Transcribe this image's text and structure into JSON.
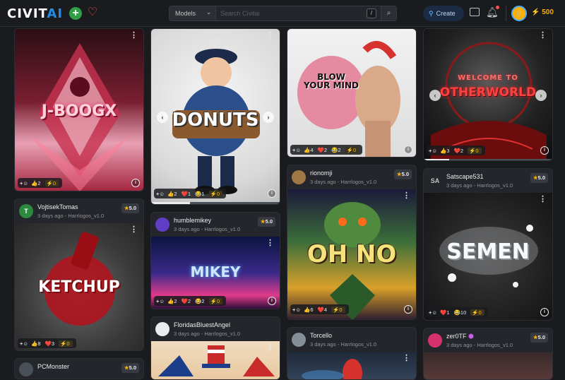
{
  "header": {
    "logo_main": "CIVIT",
    "logo_ai": "AI",
    "search_select": "Models",
    "search_placeholder": "Search Civitai",
    "slash_key": "/",
    "create_label": "Create",
    "buzz_amount": "500"
  },
  "cards": {
    "c1": {
      "art_text": "J-BOOGX",
      "likes": "2",
      "tips": "0"
    },
    "c2": {
      "art_text": "DONUTS",
      "likes": "2",
      "hearts": "1",
      "laugh": "1",
      "tips": "0",
      "progress": 0.3
    },
    "c3": {
      "art_text": "BLOW YOUR MIND",
      "likes": "4",
      "hearts": "2",
      "laugh": "2",
      "tips": "0"
    },
    "c4": {
      "art_text": "WELCOME TO",
      "art_text2": "OTHERWORLD",
      "likes": "3",
      "hearts": "2",
      "tips": "0",
      "progress": 0.2
    },
    "c5": {
      "user": "VojtisekTomas",
      "avatar": "T",
      "meta": "3 days ago - Harrlogos_v1.0",
      "rating": "5.0",
      "art_text": "KETCHUP",
      "likes": "8",
      "hearts": "3",
      "tips": "0"
    },
    "c6": {
      "user": "humblemikey",
      "meta": "3 days ago - Harrlogos_v1.0",
      "rating": "5.0",
      "art_text": "MIKEY",
      "likes": "2",
      "hearts": "2",
      "laugh": "2",
      "tips": "0"
    },
    "c7": {
      "user": "rionomji",
      "meta": "3 days ago - Harrlogos_v1.0",
      "rating": "5.0",
      "art_text": "OH NO",
      "likes": "6",
      "hearts": "4",
      "tips": "0"
    },
    "c8": {
      "user": "Satscape531",
      "avatar": "SA",
      "meta": "3 days ago - Harrlogos_v1.0",
      "rating": "5.0",
      "art_text": "SEMEN",
      "hearts": "1",
      "laugh": "10",
      "tips": "0"
    },
    "c9": {
      "user": "FloridasBluestAngel",
      "meta": "3 days ago - Harrlogos_v1.0"
    },
    "c10": {
      "user": "Torcello",
      "meta": "3 days ago - Harrlogos_v1.0"
    },
    "c11": {
      "user": "zer0TF",
      "meta": "3 days ago - Harrlogos_v1.0",
      "rating": "5.0"
    },
    "c12": {
      "user": "PCMonster",
      "rating": "5.0"
    }
  },
  "colors": {
    "accent": "#228be6",
    "buzz": "#fab005",
    "heart": "#fa5252"
  }
}
